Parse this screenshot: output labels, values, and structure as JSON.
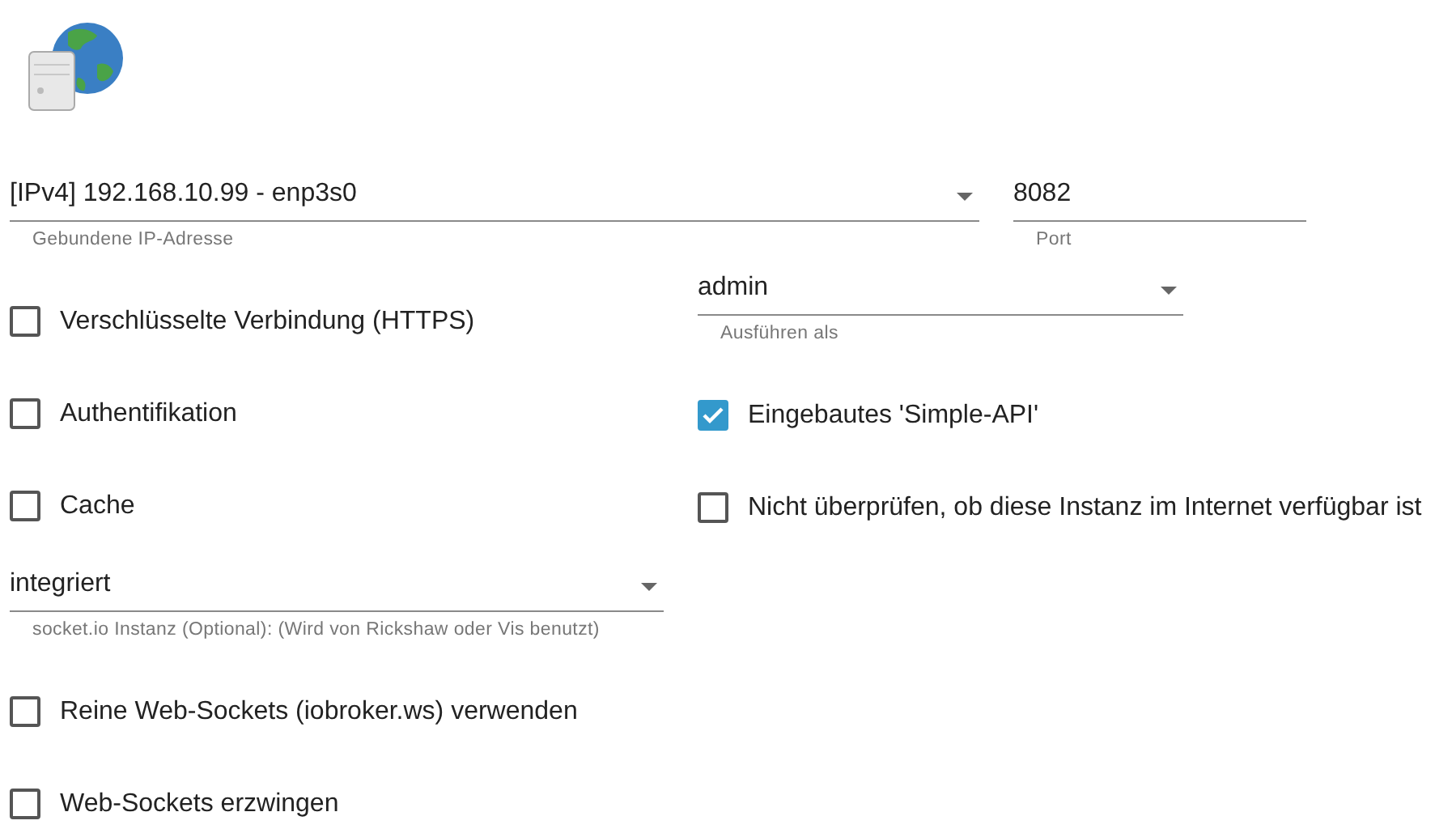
{
  "address": {
    "value": "[IPv4] 192.168.10.99 - enp3s0",
    "helper": "Gebundene IP-Adresse"
  },
  "port": {
    "value": "8082",
    "helper": "Port"
  },
  "left": [
    {
      "kind": "checkbox",
      "label": "Verschlüsselte Verbindung (HTTPS)",
      "checked": false
    },
    {
      "kind": "checkbox",
      "label": "Authentifikation",
      "checked": false
    },
    {
      "kind": "checkbox",
      "label": "Cache",
      "checked": false
    },
    {
      "kind": "select",
      "value": "integriert",
      "helper": "socket.io Instanz (Optional): (Wird von Rickshaw oder Vis benutzt)"
    },
    {
      "kind": "checkbox",
      "label": "Reine Web-Sockets (iobroker.ws) verwenden",
      "checked": false
    },
    {
      "kind": "checkbox",
      "label": "Web-Sockets erzwingen",
      "checked": false
    }
  ],
  "right": [
    {
      "kind": "select",
      "value": "admin",
      "helper": "Ausführen als"
    },
    {
      "kind": "checkbox",
      "label": "Eingebautes 'Simple-API'",
      "checked": true
    },
    {
      "kind": "checkbox",
      "label": "Nicht überprüfen, ob diese Instanz im Internet verfügbar ist",
      "checked": false
    }
  ]
}
